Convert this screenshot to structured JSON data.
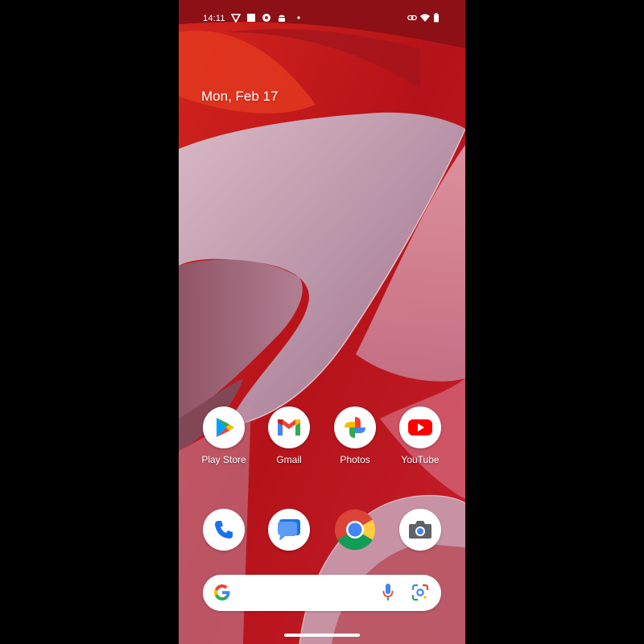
{
  "status_bar": {
    "time": "14:11",
    "left_icons": [
      "vpn-shield-icon",
      "square-notification-icon",
      "settings-notification-icon",
      "android-notification-icon",
      "dot-more-icon"
    ],
    "right_icons": [
      "link-icon",
      "wifi-icon",
      "battery-icon"
    ]
  },
  "date_widget": {
    "text": "Mon, Feb 17"
  },
  "apps_row": [
    {
      "label": "Play Store",
      "icon": "play-store-icon"
    },
    {
      "label": "Gmail",
      "icon": "gmail-icon"
    },
    {
      "label": "Photos",
      "icon": "photos-icon"
    },
    {
      "label": "YouTube",
      "icon": "youtube-icon"
    }
  ],
  "dock": [
    {
      "name": "Phone",
      "icon": "phone-icon"
    },
    {
      "name": "Messages",
      "icon": "messages-icon"
    },
    {
      "name": "Chrome",
      "icon": "chrome-icon"
    },
    {
      "name": "Camera",
      "icon": "camera-icon"
    }
  ],
  "search_bar": {
    "icons": [
      "google-g-icon",
      "mic-icon",
      "lens-icon"
    ]
  },
  "colors": {
    "wallpaper_red": "#c21a1c",
    "wallpaper_pink": "#c9a3b8",
    "google_blue": "#4285f4",
    "google_red": "#ea4335",
    "google_yellow": "#fbbc04",
    "google_green": "#34a853"
  }
}
